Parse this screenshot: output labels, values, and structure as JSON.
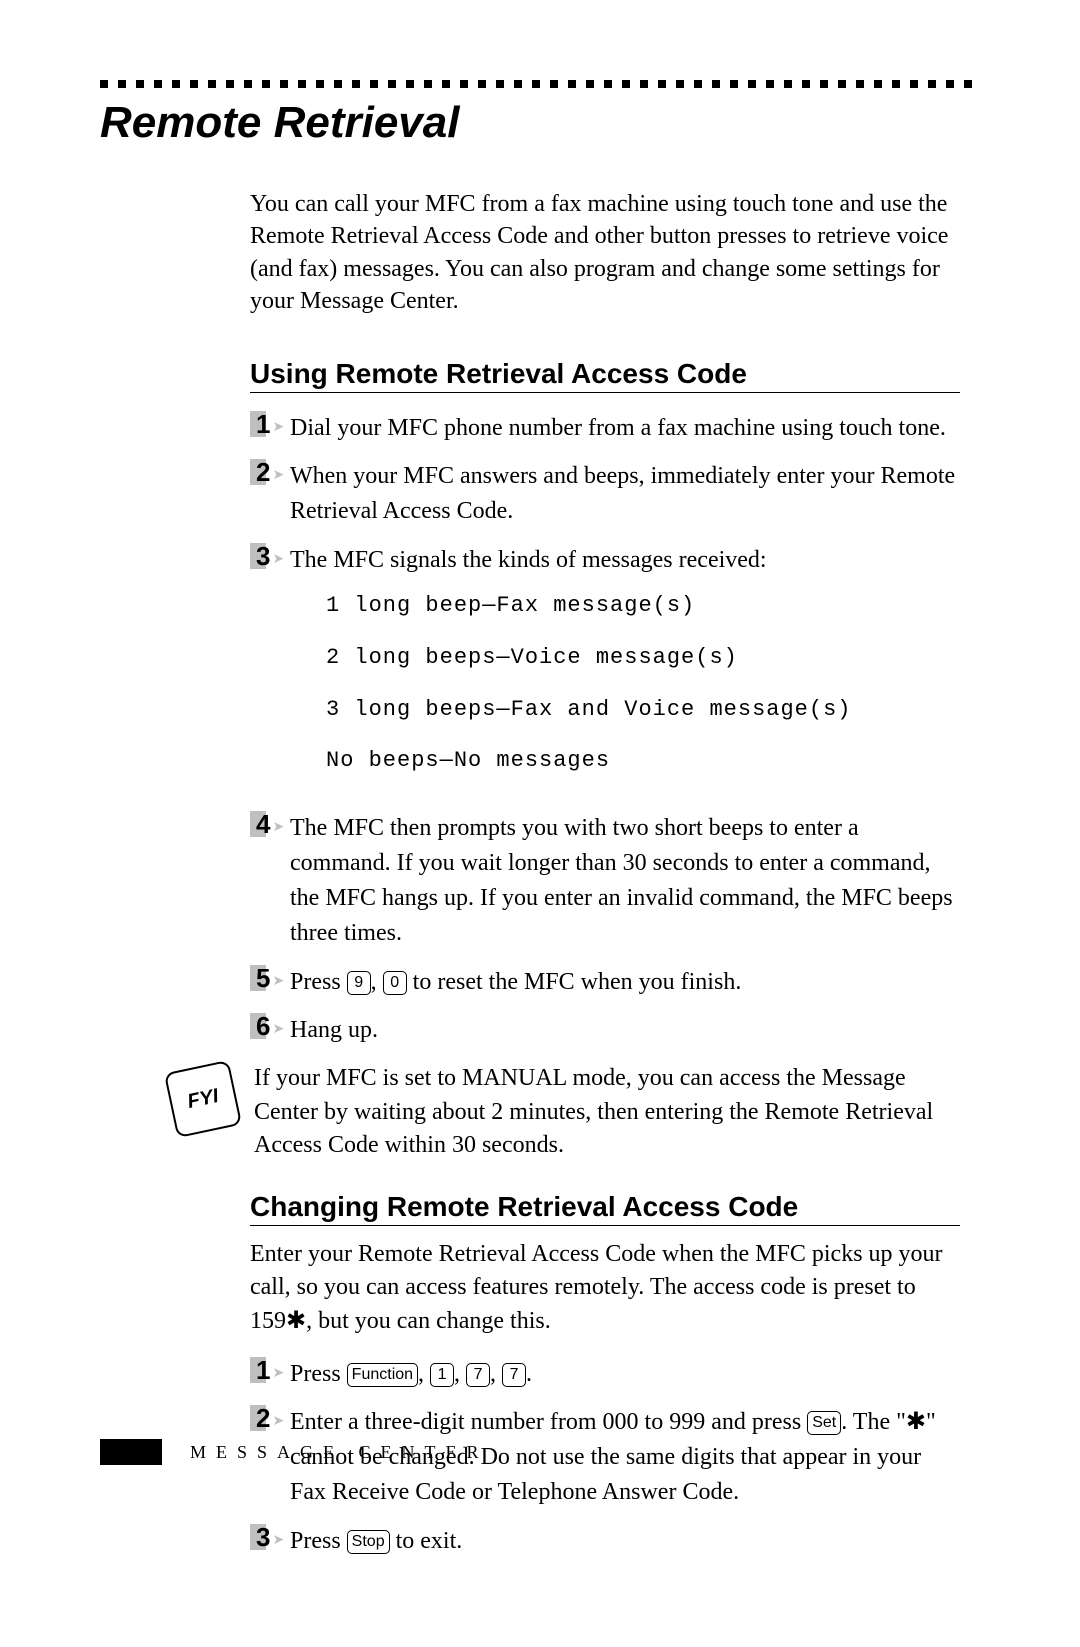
{
  "title": "Remote Retrieval",
  "intro": "You can call your MFC from a fax machine using touch tone and use the Remote Retrieval Access Code and other button presses to retrieve voice (and fax) messages. You can also program and change some settings for your Message Center.",
  "section1": {
    "heading": "Using Remote Retrieval Access Code",
    "step1": "Dial your MFC phone number from a fax machine using touch tone.",
    "step2": "When your MFC answers and beeps, immediately enter your Remote Retrieval Access Code.",
    "step3": "The MFC signals the kinds of messages received:",
    "signals": {
      "s1": "1 long beep—Fax message(s)",
      "s2": "2 long beeps—Voice message(s)",
      "s3": "3 long beeps—Fax and Voice message(s)",
      "s4": "No beeps—No messages"
    },
    "step4": "The MFC then prompts you with two short beeps to enter a command. If you wait longer than 30 seconds to enter a command, the MFC hangs up. If you enter an invalid command, the MFC beeps three times.",
    "step5_pre": "Press ",
    "step5_key1": "9",
    "step5_mid": ", ",
    "step5_key2": "0",
    "step5_post": " to reset the MFC when you finish.",
    "step6": "Hang up.",
    "note": "If your MFC is set to MANUAL mode, you can access the Message Center by waiting about 2 minutes, then entering the Remote Retrieval Access Code within 30 seconds."
  },
  "section2": {
    "heading": "Changing Remote Retrieval Access Code",
    "lead": "Enter your Remote Retrieval Access Code when the MFC picks up your call, so you can access features remotely. The access code is preset to 159✱, but you can change this.",
    "step1_pre": "Press ",
    "step1_kfunc": "Function",
    "step1_k1": "1",
    "step1_k2": "7",
    "step1_k3": "7",
    "step1_post": ".",
    "step2_pre": "Enter a three-digit number from 000 to 999 and press ",
    "step2_kset": "Set",
    "step2_post": ". The \"✱\" cannot be changed. Do not use the same digits that appear in your Fax Receive Code or Telephone Answer Code.",
    "step3_pre": "Press ",
    "step3_kstop": "Stop",
    "step3_post": " to exit."
  },
  "footer": "MESSAGE CENTER",
  "fyi_icon_label": "FYI"
}
